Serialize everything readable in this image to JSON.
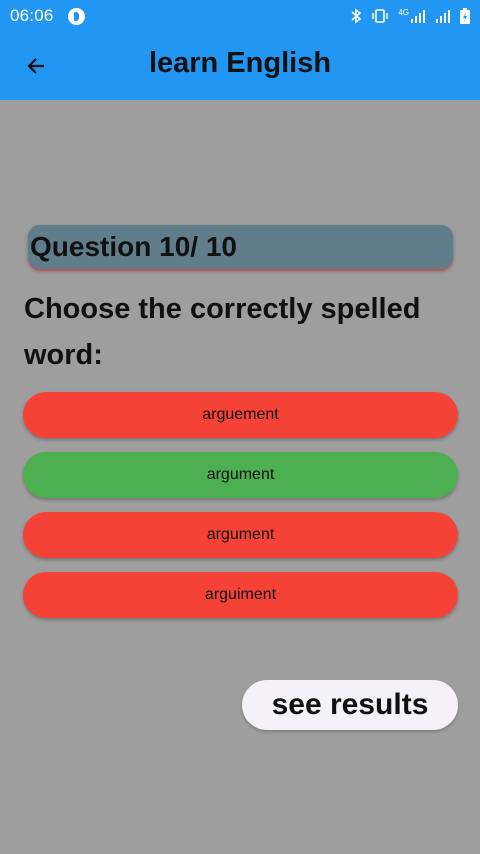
{
  "status_bar": {
    "time": "06:06",
    "network": "4G",
    "icons": [
      "app-notification-icon",
      "bluetooth-icon",
      "vibrate-icon",
      "signal-icon",
      "signal-icon",
      "battery-charging-icon"
    ]
  },
  "app_bar": {
    "title": "learn English",
    "back_icon": "arrow-left-icon"
  },
  "quiz": {
    "question_counter": "Question 10/ 10",
    "prompt": "Choose the correctly spelled word:",
    "options": [
      {
        "label": "arguement",
        "color": "#f44336"
      },
      {
        "label": "argument",
        "color": "#4caf50"
      },
      {
        "label": "argument",
        "color": "#f44336"
      },
      {
        "label": "arguiment",
        "color": "#f44336"
      }
    ]
  },
  "actions": {
    "see_results_label": "see results"
  },
  "colors": {
    "primary": "#2196f3",
    "background": "#9e9e9e",
    "question_box": "#607d8b",
    "wrong": "#f44336",
    "correct": "#4caf50"
  }
}
